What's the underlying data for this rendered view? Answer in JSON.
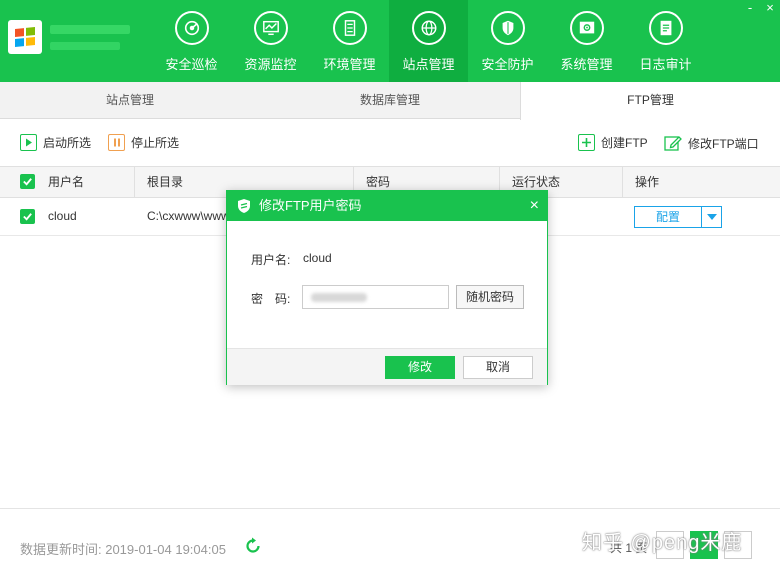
{
  "window": {
    "controls": [
      "-",
      "×"
    ]
  },
  "nav": {
    "items": [
      {
        "label": "安全巡检",
        "icon": "radar-icon"
      },
      {
        "label": "资源监控",
        "icon": "monitor-chart-icon"
      },
      {
        "label": "环境管理",
        "icon": "server-icon"
      },
      {
        "label": "站点管理",
        "icon": "globe-icon",
        "active": true
      },
      {
        "label": "安全防护",
        "icon": "shield-icon"
      },
      {
        "label": "系统管理",
        "icon": "gear-window-icon"
      },
      {
        "label": "日志审计",
        "icon": "document-icon"
      }
    ]
  },
  "subtabs": {
    "site": "站点管理",
    "db": "数据库管理",
    "ftp": "FTP管理"
  },
  "toolbar": {
    "start_label": "启动所选",
    "stop_label": "停止所选",
    "create_label": "创建FTP",
    "edit_port_label": "修改FTP端口"
  },
  "table": {
    "headers": {
      "user": "用户名",
      "root": "根目录",
      "password": "密码",
      "status": "运行状态",
      "ops": "操作"
    },
    "rows": [
      {
        "user": "cloud",
        "root": "C:\\cxwww\\www",
        "config_label": "配置"
      }
    ]
  },
  "dialog": {
    "title": "修改FTP用户密码",
    "username_label": "用户名:",
    "username_value": "cloud",
    "password_label": "密　码:",
    "random_label": "随机密码",
    "confirm_label": "修改",
    "cancel_label": "取消",
    "close_symbol": "×"
  },
  "footer": {
    "updated_text": "数据更新时间: 2019-01-04 19:04:05",
    "pager_text": "共 1 页"
  },
  "watermark": "知乎 @peng米鹿",
  "colors": {
    "brand_green": "#19c24e",
    "active_nav": "#0fae40",
    "link_blue": "#1aa3e8"
  }
}
